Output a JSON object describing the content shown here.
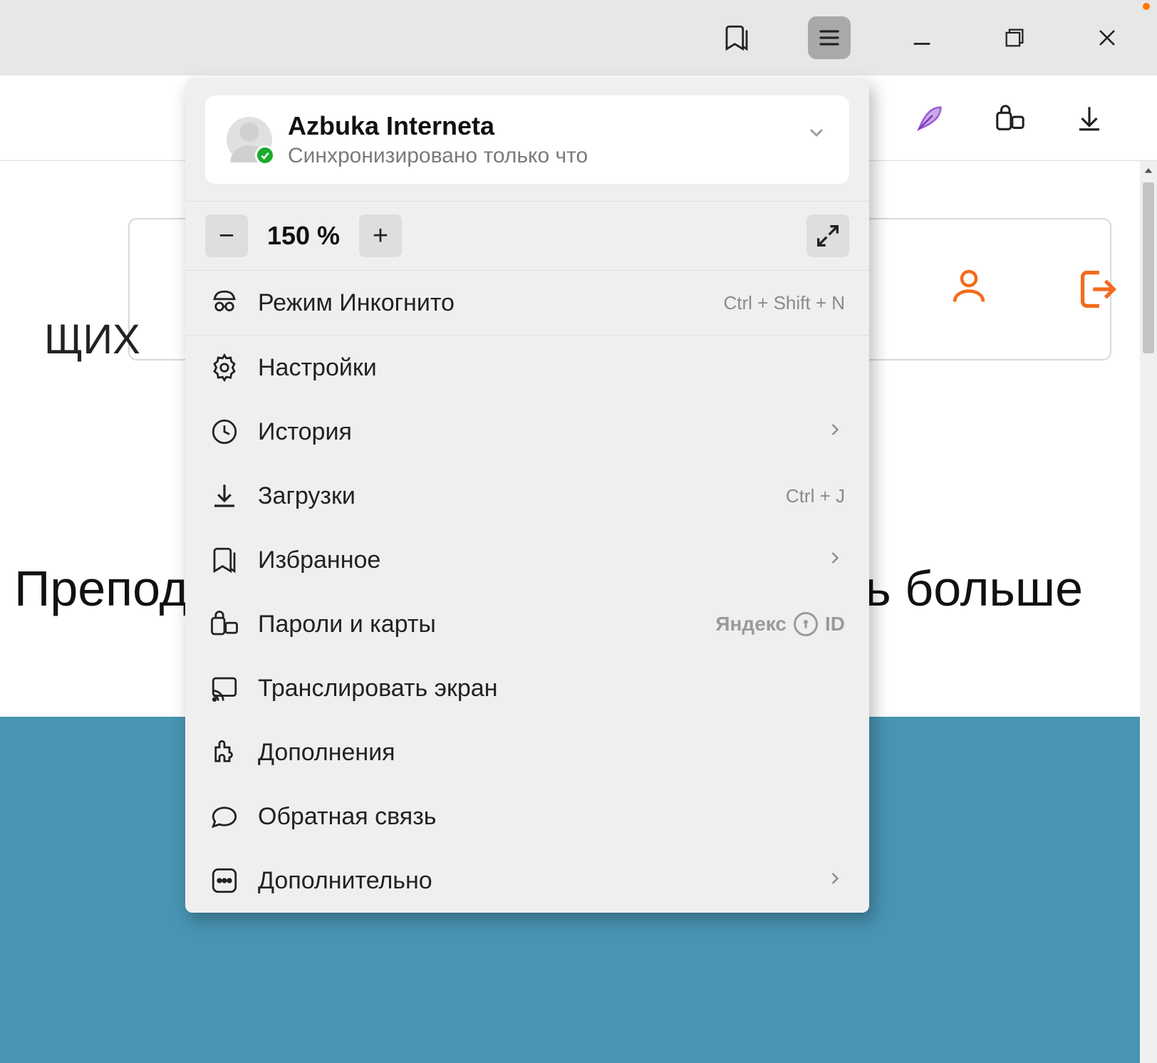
{
  "titlebar": {
    "bookmarks_icon": "bookmarks-icon",
    "menu_icon": "menu-icon"
  },
  "toolbar": {
    "feather_icon": "feather-icon",
    "passwords_icon": "passwords-icon",
    "download_icon": "download-icon"
  },
  "profile": {
    "name": "Azbuka Interneta",
    "status": "Синхронизировано только что"
  },
  "zoom": {
    "minus": "−",
    "level": "150 %",
    "plus": "+"
  },
  "menu": {
    "incognito": {
      "label": "Режим Инкогнито",
      "shortcut": "Ctrl + Shift + N"
    },
    "settings": {
      "label": "Настройки"
    },
    "history": {
      "label": "История"
    },
    "downloads": {
      "label": "Загрузки",
      "shortcut": "Ctrl + J"
    },
    "favorites": {
      "label": "Избранное"
    },
    "passwords": {
      "label": "Пароли и карты",
      "brand_left": "Яндекс",
      "brand_right": "ID"
    },
    "cast": {
      "label": "Транслировать экран"
    },
    "addons": {
      "label": "Дополнения"
    },
    "feedback": {
      "label": "Обратная связь"
    },
    "more": {
      "label": "Дополнительно"
    }
  },
  "page": {
    "partial_left": "ЩИХ",
    "heading_left": "Препод",
    "heading_right": "ь больше"
  }
}
